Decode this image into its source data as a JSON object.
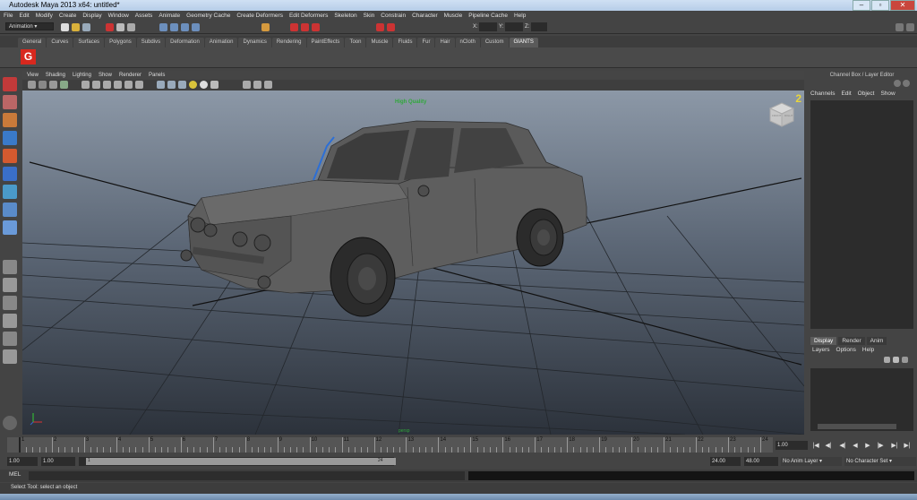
{
  "window": {
    "title": "Autodesk Maya 2013 x64: untitled*"
  },
  "menu": [
    "File",
    "Edit",
    "Modify",
    "Create",
    "Display",
    "Window",
    "Assets",
    "Animate",
    "Geometry Cache",
    "Create Deformers",
    "Edit Deformers",
    "Skeleton",
    "Skin",
    "Constrain",
    "Character",
    "Muscle",
    "Pipeline Cache",
    "Help"
  ],
  "status": {
    "mode": "Animation",
    "x_label": "X:",
    "y_label": "Y:",
    "z_label": "Z:"
  },
  "shelf": {
    "tabs": [
      "General",
      "Curves",
      "Surfaces",
      "Polygons",
      "Subdivs",
      "Deformation",
      "Animation",
      "Dynamics",
      "Rendering",
      "PaintEffects",
      "Toon",
      "Muscle",
      "Fluids",
      "Fur",
      "Hair",
      "nCloth",
      "Custom",
      "GIANTS"
    ],
    "active_tab": "GIANTS",
    "icon_label": "G"
  },
  "viewport": {
    "menu": [
      "View",
      "Shading",
      "Lighting",
      "Show",
      "Renderer",
      "Panels"
    ],
    "hud_text": "High Quality",
    "camera": "persp",
    "cube_labels": [
      "FRONT",
      "RIGHT"
    ],
    "quality_badge": "2"
  },
  "channel_box": {
    "header": "Channel Box / Layer Editor",
    "menu": [
      "Channels",
      "Edit",
      "Object",
      "Show"
    ]
  },
  "layer_editor": {
    "tabs": [
      "Display",
      "Render",
      "Anim"
    ],
    "active_tab": "Display",
    "menu": [
      "Layers",
      "Options",
      "Help"
    ]
  },
  "timeline": {
    "ticks": [
      "1",
      "2",
      "3",
      "4",
      "5",
      "6",
      "7",
      "8",
      "9",
      "10",
      "11",
      "12",
      "13",
      "14",
      "15",
      "16",
      "17",
      "18",
      "19",
      "20",
      "21",
      "22",
      "23",
      "24"
    ],
    "current_frame": "1.00"
  },
  "range": {
    "start": "1.00",
    "start2": "1.00",
    "slider_start": "1",
    "slider_end": "24",
    "end": "24.00",
    "end2": "48.00",
    "anim_layer": "No Anim Layer",
    "character_set": "No Character Set"
  },
  "command": {
    "mel_label": "MEL"
  },
  "help_line": "Select Tool: select an object",
  "colors": {
    "accent_red": "#d8281e",
    "hud_green": "#2fa83a",
    "timeline": "#555555"
  }
}
